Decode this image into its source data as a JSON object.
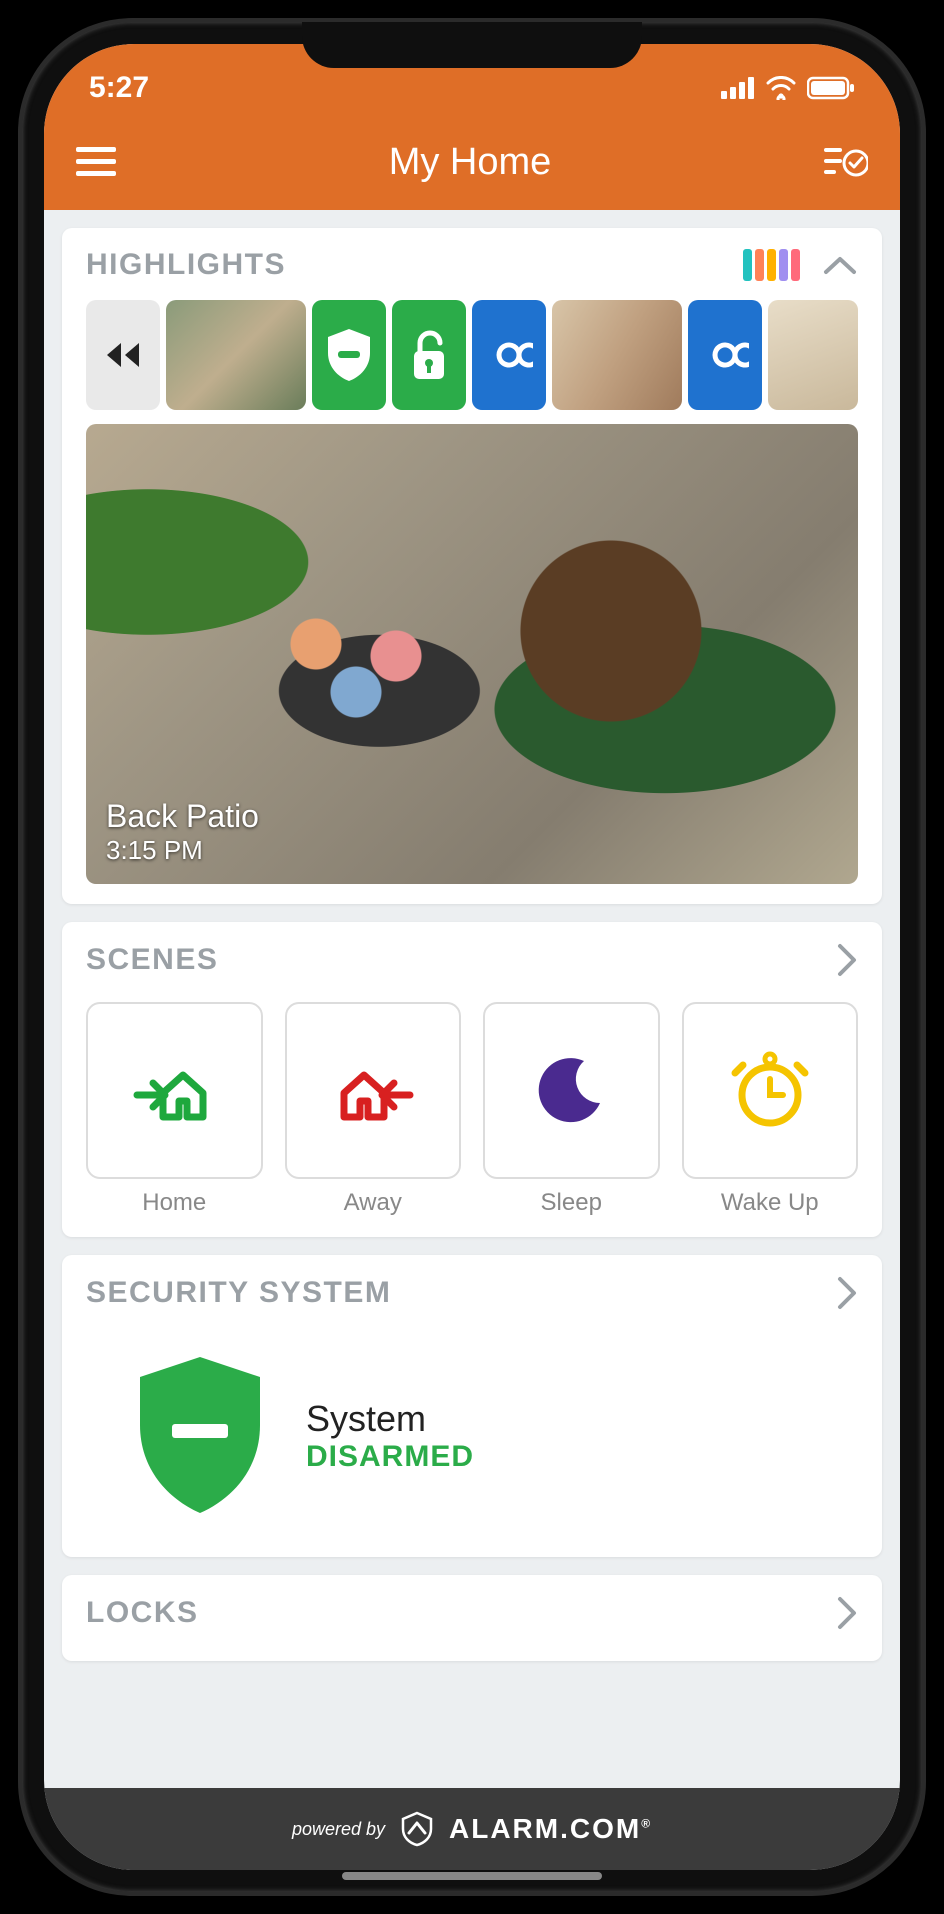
{
  "status_bar": {
    "time": "5:27"
  },
  "header": {
    "title": "My Home"
  },
  "highlights": {
    "title": "HIGHLIGHTS",
    "color_bars": [
      "#22c2bf",
      "#ff8257",
      "#ffb100",
      "#a08ff0",
      "#ff6a7b"
    ],
    "timeline": [
      {
        "type": "back"
      },
      {
        "type": "camera-thumb",
        "name": "patio-thumb"
      },
      {
        "type": "shield-icon"
      },
      {
        "type": "unlock-icon"
      },
      {
        "type": "link-icon"
      },
      {
        "type": "camera-thumb",
        "name": "living-thumb"
      },
      {
        "type": "link-icon"
      },
      {
        "type": "camera-thumb",
        "name": "entry-thumb"
      }
    ],
    "main_camera": {
      "name": "Back Patio",
      "time": "3:15 PM"
    }
  },
  "scenes": {
    "title": "SCENES",
    "items": [
      {
        "label": "Home",
        "icon": "home-in-icon",
        "color": "#1ea83d"
      },
      {
        "label": "Away",
        "icon": "home-out-icon",
        "color": "#d82020"
      },
      {
        "label": "Sleep",
        "icon": "moon-icon",
        "color": "#4a2a8f"
      },
      {
        "label": "Wake Up",
        "icon": "alarm-clock-icon",
        "color": "#f5c400"
      }
    ]
  },
  "security": {
    "title": "SECURITY SYSTEM",
    "label": "System",
    "status": "DISARMED",
    "shield_color": "#2bac49"
  },
  "locks": {
    "title": "LOCKS"
  },
  "footer": {
    "prefix": "powered by",
    "brand": "ALARM.COM"
  }
}
